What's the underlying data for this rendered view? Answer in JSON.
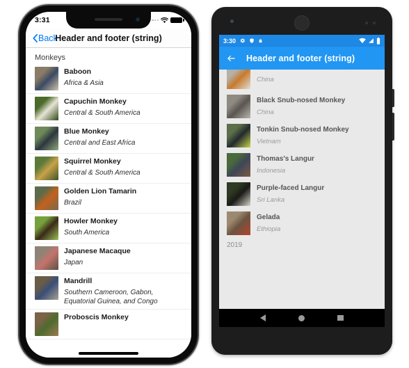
{
  "ios": {
    "status": {
      "time": "3:31",
      "wifi_icon": "wifi-icon",
      "battery_icon": "battery-icon",
      "signal_icon": "signal-dots-icon"
    },
    "navbar": {
      "back_label": "Back",
      "title": "Header and footer (string)",
      "back_icon": "chevron-left-icon"
    },
    "section_header": "Monkeys",
    "rows": [
      {
        "title": "Baboon",
        "subtitle": "Africa & Asia",
        "thumb": "baboon-thumb",
        "c1": "#8a7c66",
        "c2": "#3b4a63",
        "c3": "#cfc3ac"
      },
      {
        "title": "Capuchin Monkey",
        "subtitle": "Central & South America",
        "thumb": "capuchin-thumb",
        "c1": "#4a6b2a",
        "c2": "#e8e4d6",
        "c3": "#2f4a18"
      },
      {
        "title": "Blue Monkey",
        "subtitle": "Central and East Africa",
        "thumb": "blue-monkey-thumb",
        "c1": "#6d8a58",
        "c2": "#2d3640",
        "c3": "#8fa87a"
      },
      {
        "title": "Squirrel Monkey",
        "subtitle": "Central & South America",
        "thumb": "squirrel-monkey-thumb",
        "c1": "#5e7a3a",
        "c2": "#c8a24a",
        "c3": "#3e5426"
      },
      {
        "title": "Golden Lion Tamarin",
        "subtitle": "Brazil",
        "thumb": "golden-lion-tamarin-thumb",
        "c1": "#5d6b4a",
        "c2": "#c2611e",
        "c3": "#7a6a4e"
      },
      {
        "title": "Howler Monkey",
        "subtitle": "South America",
        "thumb": "howler-monkey-thumb",
        "c1": "#77a13d",
        "c2": "#3a2a18",
        "c3": "#9cc05a"
      },
      {
        "title": "Japanese Macaque",
        "subtitle": "Japan",
        "thumb": "japanese-macaque-thumb",
        "c1": "#8f8376",
        "c2": "#c4736c",
        "c3": "#5c5248"
      },
      {
        "title": "Mandrill",
        "subtitle": "Southern Cameroon, Gabon, Equatorial Guinea, and Congo",
        "thumb": "mandrill-thumb",
        "c1": "#6b5c46",
        "c2": "#3a4e78",
        "c3": "#a8a290"
      },
      {
        "title": "Proboscis Monkey",
        "subtitle": "",
        "thumb": "proboscis-monkey-thumb",
        "c1": "#7b6348",
        "c2": "#4d6b2c",
        "c3": "#9c7a52"
      }
    ]
  },
  "android": {
    "status": {
      "time": "3:30",
      "icons": [
        "gear-icon",
        "shield-icon",
        "lock-icon"
      ],
      "right_icons": [
        "wifi-icon",
        "signal-icon",
        "battery-icon"
      ]
    },
    "appbar": {
      "back_icon": "arrow-left-icon",
      "title": "Header and footer (string)"
    },
    "rows": [
      {
        "title": "",
        "subtitle": "China",
        "thumb": "golden-snub-nosed-monkey-thumb",
        "c1": "#b5b0a8",
        "c2": "#c77a2c",
        "c3": "#e2ddd6"
      },
      {
        "title": "Black Snub-nosed Monkey",
        "subtitle": "China",
        "thumb": "black-snub-nosed-monkey-thumb",
        "c1": "#8f8a82",
        "c2": "#5a5550",
        "c3": "#b8b4ad"
      },
      {
        "title": "Tonkin Snub-nosed Monkey",
        "subtitle": "Vietnam",
        "thumb": "tonkin-snub-nosed-monkey-thumb",
        "c1": "#5c6e4a",
        "c2": "#222a2e",
        "c3": "#c9d44a"
      },
      {
        "title": "Thomas's Langur",
        "subtitle": "Indonesia",
        "thumb": "thomass-langur-thumb",
        "c1": "#4a6a3c",
        "c2": "#3d4756",
        "c3": "#7d5a48"
      },
      {
        "title": "Purple-faced Langur",
        "subtitle": "Sri Lanka",
        "thumb": "purple-faced-langur-thumb",
        "c1": "#2e3a22",
        "c2": "#1a1a18",
        "c3": "#d8d4c8"
      },
      {
        "title": "Gelada",
        "subtitle": "Ethiopia",
        "thumb": "gelada-thumb",
        "c1": "#9c8a70",
        "c2": "#6b5440",
        "c3": "#b5432e"
      }
    ],
    "footer": "2019",
    "navbar": {
      "back_icon": "nav-back-icon",
      "home_icon": "nav-home-icon",
      "recents_icon": "nav-recents-icon"
    }
  },
  "colors": {
    "ios_accent": "#007aff",
    "android_appbar": "#2196f3",
    "android_statusbar": "#1e88e5",
    "android_bg": "#e9e9e9"
  }
}
